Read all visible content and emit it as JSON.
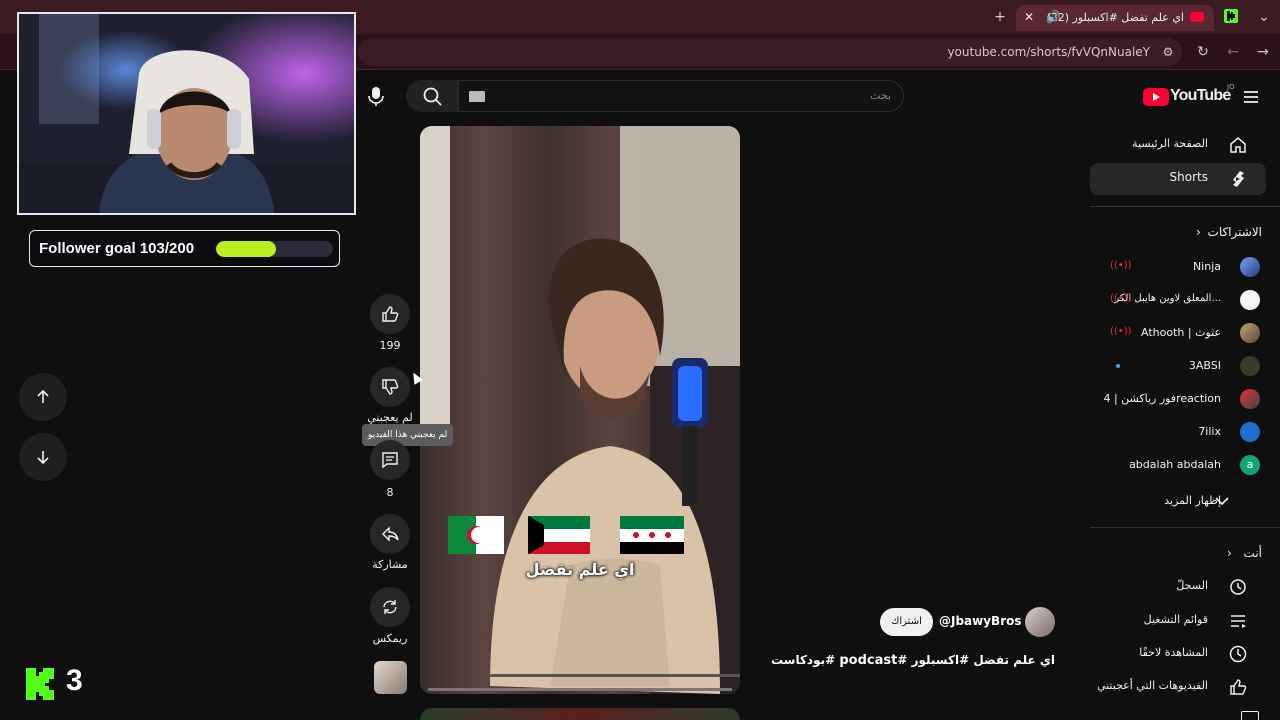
{
  "browser": {
    "tab_title": "(32) اي علم تفضل #اكسبلور",
    "url": "youtube.com/shorts/fvVQnNualeY"
  },
  "youtube": {
    "logo_text": "YouTube",
    "country_code": "JO",
    "search_placeholder": "بحث",
    "sidebar": {
      "home": "الصفحة الرئيسية",
      "shorts": "Shorts",
      "subscriptions_header": "الاشتراكات",
      "subscriptions": [
        {
          "name": "Ninja",
          "live": true
        },
        {
          "name": "المعلق لاوين هايبل الكر...",
          "live": true
        },
        {
          "name": "Athooth | عثوث",
          "live": true
        },
        {
          "name": "3ABSI",
          "live": false,
          "new": true
        },
        {
          "name": "فور رياكشن | 4reaction",
          "live": false
        },
        {
          "name": "7ilix",
          "live": false
        },
        {
          "name": "abdalah abdalah",
          "live": false,
          "avatar_letter": "a"
        }
      ],
      "show_more": "إظهار المزيد",
      "you_header": "أنت",
      "you_items": [
        "السجلّ",
        "قوائم التشغيل",
        "المشاهدة لاحقًا",
        "الفيديوهات التي أعجبتني"
      ]
    },
    "short": {
      "caption_overlay": "اي علم تفضل",
      "channel": "@JbawyBros",
      "subscribe_label": "اشتراك",
      "title_prefix": "اي علم تفضل #اكسبلور #",
      "title_bold": "podcast",
      "title_suffix": " #بودكاست"
    },
    "actions": {
      "like_count": "199",
      "dislike_label": "لم يعجبني",
      "dislike_tooltip": "لم يعجبني هذا الفيديو",
      "comment_count": "8",
      "share_label": "مشاركة",
      "remix_label": "ريمكس"
    }
  },
  "overlay": {
    "follower_goal_text": "Follower goal 103/200",
    "follower_goal_progress": 0.515,
    "kick_count": "3"
  }
}
